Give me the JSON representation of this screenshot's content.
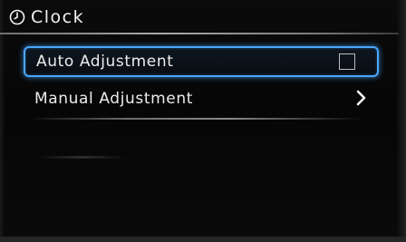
{
  "header": {
    "title": "Clock",
    "icon": "clock-icon"
  },
  "menu": {
    "items": [
      {
        "label": "Auto Adjustment",
        "control": "checkbox",
        "checked": false,
        "selected": true
      },
      {
        "label": "Manual Adjustment",
        "control": "chevron-right-icon",
        "selected": false
      }
    ]
  },
  "colors": {
    "selection_highlight": "#4aa7ff",
    "background": "#050505",
    "text": "#ececec"
  }
}
